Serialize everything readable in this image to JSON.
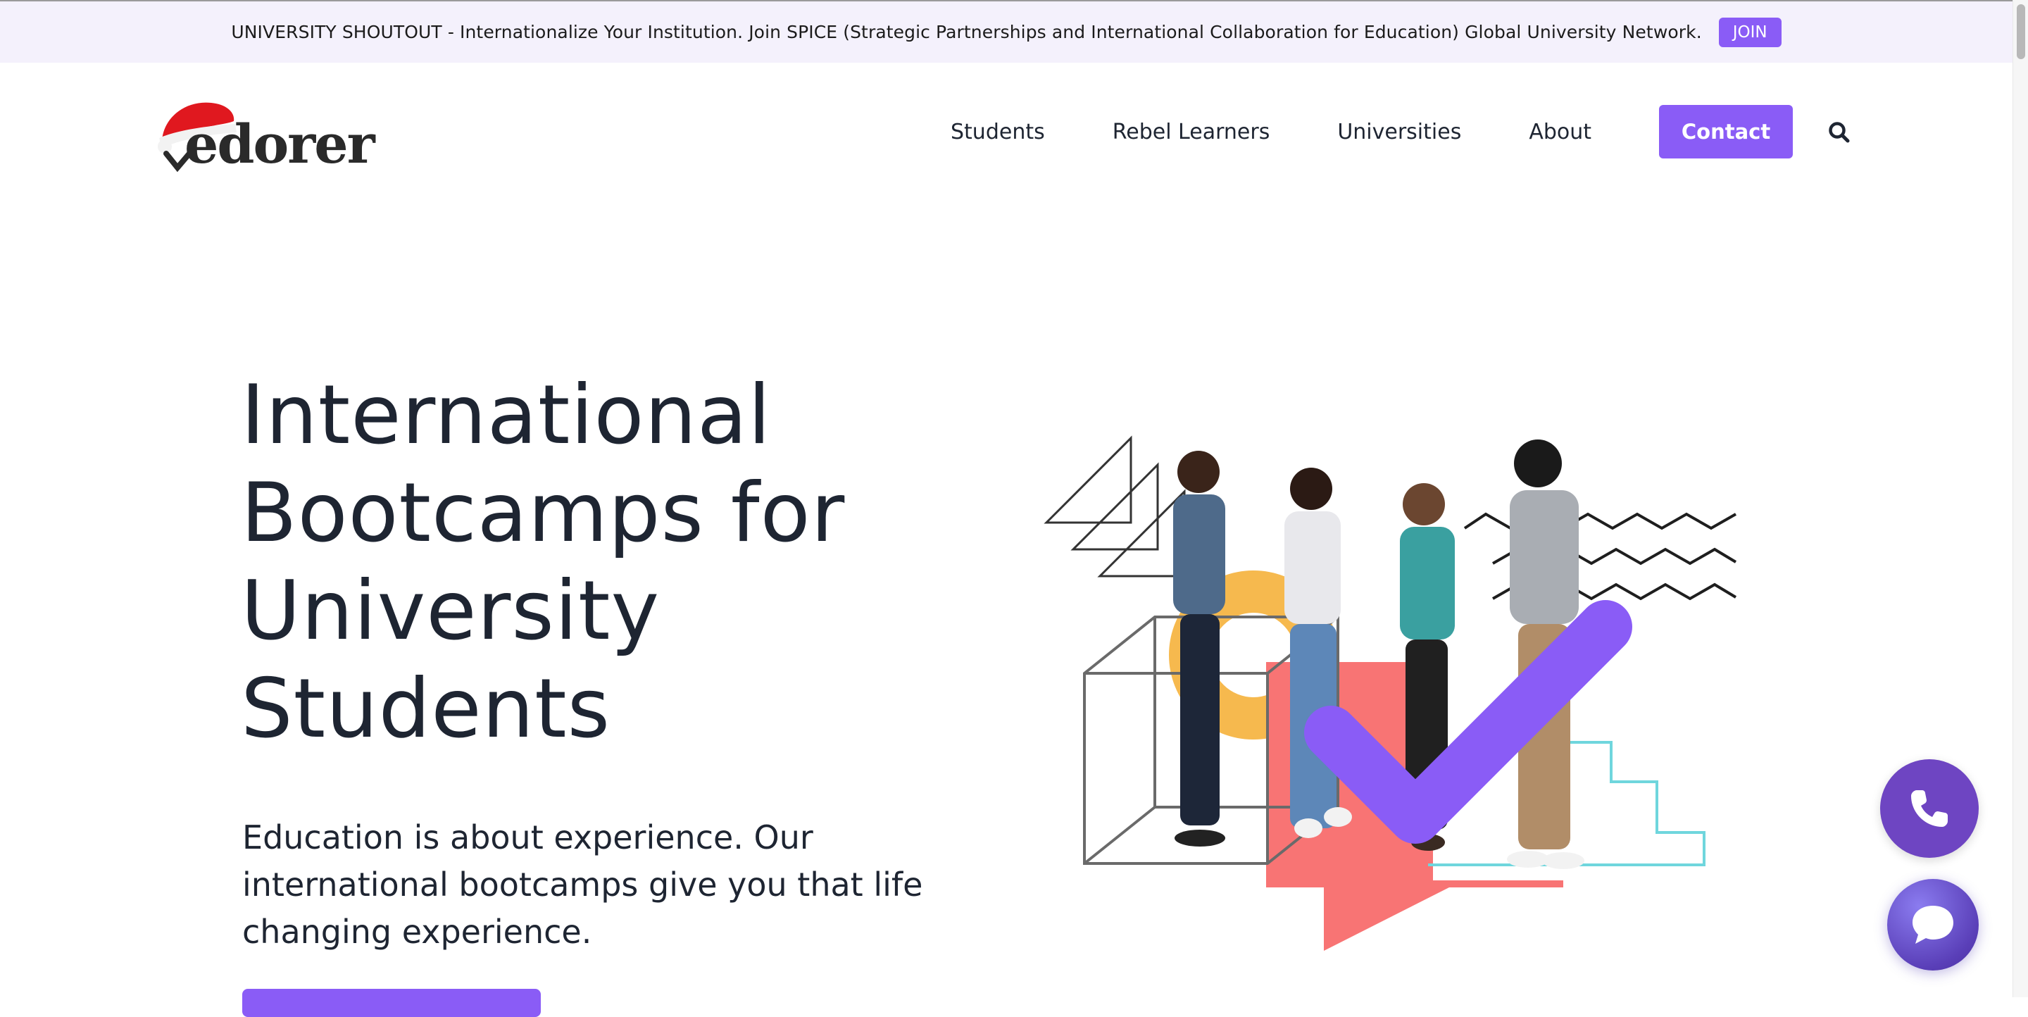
{
  "announcement": {
    "text": "UNIVERSITY SHOUTOUT - Internationalize Your Institution. Join SPICE (Strategic Partnerships and International Collaboration for Education) Global University Network.",
    "join_label": "JOIN"
  },
  "logo": {
    "text": "edorer"
  },
  "nav": {
    "items": [
      "Students",
      "Rebel Learners",
      "Universities",
      "About"
    ],
    "contact_label": "Contact"
  },
  "hero": {
    "title_lines": [
      "International",
      "Bootcamps for",
      "University",
      "Students"
    ],
    "subtitle_lines": [
      "Education is about experience. Our",
      "international bootcamps give you that life",
      "changing experience."
    ]
  },
  "colors": {
    "accent": "#8a5cf6",
    "announce_bg": "#f4f1fc",
    "text": "#1e2532",
    "phone_fab": "#6e45c2",
    "coral": "#f87474",
    "mustard": "#f6b94e",
    "teal": "#6fd6dd"
  },
  "icons": {
    "search": "search-icon",
    "phone": "phone-icon",
    "chat": "chat-bubble-icon",
    "santa_hat": "santa-hat-icon",
    "checkmark": "checkmark-icon"
  }
}
